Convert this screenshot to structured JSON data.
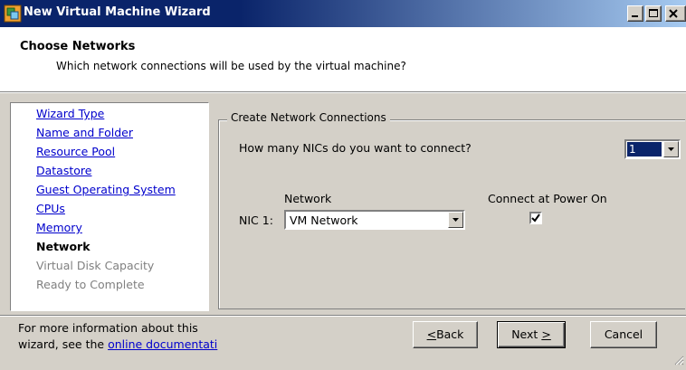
{
  "window": {
    "title": "New Virtual Machine Wizard",
    "icon": "vm-wizard-icon",
    "controls": [
      "minimize-icon",
      "maximize-icon",
      "close-icon"
    ]
  },
  "header": {
    "title": "Choose Networks",
    "subtitle": "Which network connections will be used by the virtual machine?"
  },
  "steps": [
    {
      "label": "Wizard Type",
      "state": "link"
    },
    {
      "label": "Name and Folder",
      "state": "link"
    },
    {
      "label": "Resource Pool",
      "state": "link"
    },
    {
      "label": "Datastore",
      "state": "link"
    },
    {
      "label": "Guest Operating System",
      "state": "link"
    },
    {
      "label": "CPUs",
      "state": "link"
    },
    {
      "label": "Memory",
      "state": "link"
    },
    {
      "label": "Network",
      "state": "current"
    },
    {
      "label": "Virtual Disk Capacity",
      "state": "pending"
    },
    {
      "label": "Ready to Complete",
      "state": "pending"
    }
  ],
  "network_group": {
    "legend": "Create Network Connections",
    "question": "How many NICs do you want to connect?",
    "nic_count": "1",
    "col_network": "Network",
    "col_power": "Connect at Power On",
    "nic_label": "NIC 1:",
    "nic_network": "VM Network",
    "connect_at_power_on": true
  },
  "footer": {
    "info_line1": "For more information about this",
    "info_line2_prefix": "wizard, see the ",
    "info_link": "online documentati",
    "back_label": "Back",
    "back_accel": "<",
    "next_label": "Next",
    "next_accel": ">",
    "cancel_label": "Cancel"
  },
  "colors": {
    "title_bar": "#0a246a",
    "dialog_face": "#d4d0c8",
    "link": "#0000cc",
    "selection": "#0a246a"
  }
}
